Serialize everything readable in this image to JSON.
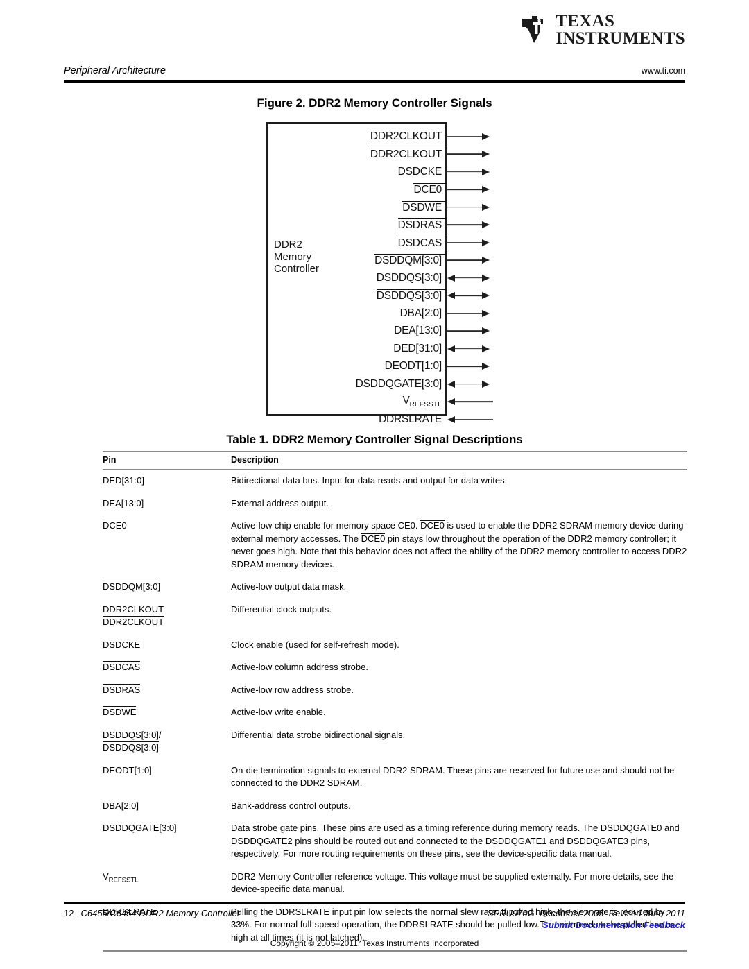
{
  "header": {
    "section": "Peripheral Architecture",
    "website": "www.ti.com",
    "logo_line1": "TEXAS",
    "logo_line2": "INSTRUMENTS"
  },
  "figure": {
    "title": "Figure 2. DDR2 Memory Controller Signals",
    "block_label_line1": "DDR2",
    "block_label_line2": "Memory",
    "block_label_line3": "Controller",
    "signals": [
      {
        "name": "DDR2CLKOUT",
        "overline": false,
        "direction": "out"
      },
      {
        "name": "DDR2CLKOUT",
        "overline": true,
        "direction": "out"
      },
      {
        "name": "DSDCKE",
        "overline": false,
        "direction": "out"
      },
      {
        "name": "DCE0",
        "overline": true,
        "direction": "out"
      },
      {
        "name": "DSDWE",
        "overline": true,
        "direction": "out"
      },
      {
        "name": "DSDRAS",
        "overline": true,
        "direction": "out"
      },
      {
        "name": "DSDCAS",
        "overline": true,
        "direction": "out"
      },
      {
        "name": "DSDDQM[3:0]",
        "overline": true,
        "direction": "out"
      },
      {
        "name": "DSDDQS[3:0]",
        "overline": false,
        "direction": "bidir"
      },
      {
        "name": "DSDDQS[3:0]",
        "overline": true,
        "direction": "bidir"
      },
      {
        "name": "DBA[2:0]",
        "overline": false,
        "direction": "out"
      },
      {
        "name": "DEA[13:0]",
        "overline": false,
        "direction": "out"
      },
      {
        "name": "DED[31:0]",
        "overline": false,
        "direction": "bidir"
      },
      {
        "name": "DEODT[1:0]",
        "overline": false,
        "direction": "out"
      },
      {
        "name": "DSDDQGATE[3:0]",
        "overline": false,
        "direction": "bidir"
      },
      {
        "name": "V",
        "subscript": "REFSSTL",
        "overline": false,
        "direction": "in"
      },
      {
        "name": "DDRSLRATE",
        "overline": false,
        "direction": "in"
      }
    ]
  },
  "table": {
    "title": "Table 1. DDR2 Memory Controller Signal Descriptions",
    "columns": [
      "Pin",
      "Description"
    ],
    "rows": [
      {
        "pin_lines": [
          {
            "text": "DED[31:0]",
            "overline": false
          }
        ],
        "description": "Bidirectional data bus. Input for data reads and output for data writes."
      },
      {
        "pin_lines": [
          {
            "text": "DEA[13:0]",
            "overline": false
          }
        ],
        "description": "External address output."
      },
      {
        "pin_lines": [
          {
            "text": "DCE0",
            "overline": true
          }
        ],
        "description_parts": [
          {
            "text": "Active-low chip enable for memory space CE0. ",
            "overline": false
          },
          {
            "text": "DCE0",
            "overline": true
          },
          {
            "text": " is used to enable the DDR2 SDRAM memory device during external memory accesses. The ",
            "overline": false
          },
          {
            "text": "DCE0",
            "overline": true
          },
          {
            "text": " pin stays low throughout the operation of the DDR2 memory controller; it never goes high. Note that this behavior does not affect the ability of the DDR2 memory controller to access DDR2 SDRAM memory devices.",
            "overline": false
          }
        ]
      },
      {
        "pin_lines": [
          {
            "text": "DSDDQM[3:0]",
            "overline": true
          }
        ],
        "description": "Active-low output data mask."
      },
      {
        "pin_lines": [
          {
            "text": "DDR2CLKOUT",
            "overline": false
          },
          {
            "text": "DDR2CLKOUT",
            "overline": true
          }
        ],
        "description": "Differential clock outputs."
      },
      {
        "pin_lines": [
          {
            "text": "DSDCKE",
            "overline": false
          }
        ],
        "description": "Clock enable (used for self-refresh mode)."
      },
      {
        "pin_lines": [
          {
            "text": "DSDCAS",
            "overline": true
          }
        ],
        "description": "Active-low column address strobe."
      },
      {
        "pin_lines": [
          {
            "text": "DSDRAS",
            "overline": true
          }
        ],
        "description": "Active-low row address strobe."
      },
      {
        "pin_lines": [
          {
            "text": "DSDWE",
            "overline": true
          }
        ],
        "description": "Active-low write enable."
      },
      {
        "pin_lines": [
          {
            "text": "DSDDQS[3:0]/",
            "overline": false
          },
          {
            "text": "DSDDQS[3:0]",
            "overline": true
          }
        ],
        "description": "Differential data strobe bidirectional signals."
      },
      {
        "pin_lines": [
          {
            "text": "DEODT[1:0]",
            "overline": false
          }
        ],
        "description": "On-die termination signals to external DDR2 SDRAM. These pins are reserved for future use and should not be connected to the DDR2 SDRAM."
      },
      {
        "pin_lines": [
          {
            "text": "DBA[2:0]",
            "overline": false
          }
        ],
        "description": "Bank-address control outputs."
      },
      {
        "pin_lines": [
          {
            "text": "DSDDQGATE[3:0]",
            "overline": false
          }
        ],
        "description": "Data strobe gate pins. These pins are used as a timing reference during memory reads. The DSDDQGATE0 and DSDDQGATE2 pins should be routed out and connected to the DSDDQGATE1 and DSDDQGATE3 pins, respectively. For more routing requirements on these pins, see the device-specific data manual."
      },
      {
        "pin_lines": [
          {
            "text": "V",
            "subscript": "REFSSTL",
            "overline": false
          }
        ],
        "description": "DDR2 Memory Controller reference voltage. This voltage must be supplied externally. For more details, see the device-specific data manual."
      },
      {
        "pin_lines": [
          {
            "text": "DDRSLRATE",
            "overline": false
          }
        ],
        "description": "Pulling the DDRSLRATE input pin low selects the normal slew rate. If pulled high, the slew rate is reduced by 33%. For normal full-speed operation, the DDRSLRATE should be pulled low.This pin needs to be pulled low or high at all times (it is not latched)."
      }
    ]
  },
  "footer": {
    "page_number": "12",
    "document_name": "C6455/C6454 DDR2 Memory Controller",
    "doc_id": "SPRU970G–December 2005–Revised June 2011",
    "feedback_link": "Submit Documentation Feedback",
    "copyright": "Copyright © 2005–2011, Texas Instruments Incorporated"
  },
  "colors": {
    "link": "#2222cc",
    "rule": "#000000",
    "table_rule": "#8a8a8a"
  }
}
